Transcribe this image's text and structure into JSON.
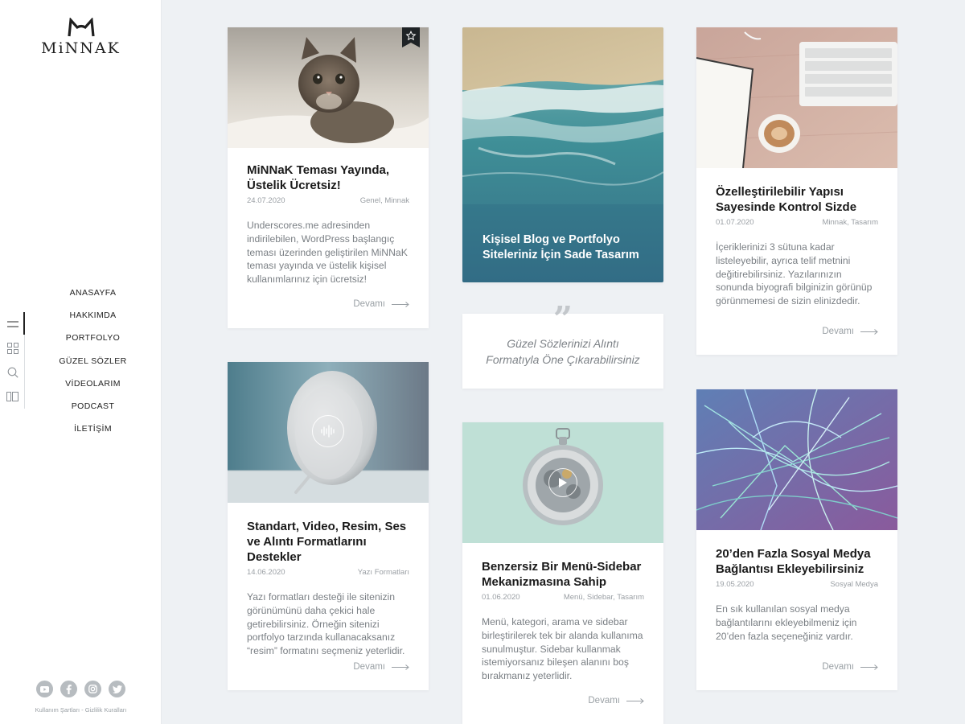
{
  "brand": {
    "name": "MiNNAK"
  },
  "nav": {
    "items": [
      "ANASAYFA",
      "HAKKIMDA",
      "PORTFOLYO",
      "GÜZEL SÖZLER",
      "VİDEOLARIM",
      "PODCAST",
      "İLETİŞİM"
    ]
  },
  "tools": [
    "menu-icon",
    "grid-icon",
    "search-icon",
    "sidebar-layout-icon"
  ],
  "social": [
    "youtube-icon",
    "facebook-icon",
    "instagram-icon",
    "twitter-icon"
  ],
  "footer": {
    "terms": "Kullanım Şartları",
    "separator": " - ",
    "privacy": "Gizlilik Kuralları"
  },
  "more_label": "Devamı",
  "posts": [
    {
      "title": "MiNNaK Teması Yayında, Üstelik Ücretsiz!",
      "date": "24.07.2020",
      "categories": "Genel, Minnak",
      "excerpt": "Underscores.me adresinden indirilebilen, WordPress başlangıç teması üzerinden geliştirilen MiNNaK teması yayında ve üstelik kişisel kullanımlarınız için ücretsiz!",
      "sticky_icon": "star-icon"
    },
    {
      "title": "Standart, Video, Resim, Ses ve Alıntı Formatlarını Destekler",
      "date": "14.06.2020",
      "categories": "Yazı Formatları",
      "excerpt": "Yazı formatları desteği ile sitenizin görünümünü daha çekici hale getirebilirsiniz. Örneğin sitenizi portfolyo tarzında kullanacaksanız “resim” formatını seçmeniz yeterlidir."
    },
    {
      "title": "Kişisel Blog ve Portfolyo Siteleriniz İçin Sade Tasarım"
    },
    {
      "quote": "Güzel Sözlerinizi Alıntı Formatıyla Öne Çıkarabilirsiniz"
    },
    {
      "title": "Benzersiz Bir Menü-Sidebar Mekanizmasına Sahip",
      "date": "01.06.2020",
      "categories": "Menü, Sidebar, Tasarım",
      "excerpt": "Menü, kategori, arama ve sidebar birleştirilerek tek bir alanda kullanıma sunulmuştur. Sidebar kullanmak istemiyorsanız bileşen alanını boş bırakmanız  yeterlidir."
    },
    {
      "title": "Özelleştirilebilir Yapısı Sayesinde Kontrol Sizde",
      "date": "01.07.2020",
      "categories": "Minnak, Tasarım",
      "excerpt": "İçeriklerinizi 3 sütuna kadar listeleyebilir, ayrıca telif metnini değitirebilirsiniz. Yazılarınızın sonunda biyografi bilginizin görünüp görünmemesi de sizin elinizdedir."
    },
    {
      "title": "20’den Fazla Sosyal Medya Bağlantısı Ekleyebilirsiniz",
      "date": "19.05.2020",
      "categories": "Sosyal Medya",
      "excerpt": "En sık kullanılan sosyal medya bağlantılarını ekleyebilmeniz için 20’den fazla seçeneğiniz vardır."
    }
  ]
}
